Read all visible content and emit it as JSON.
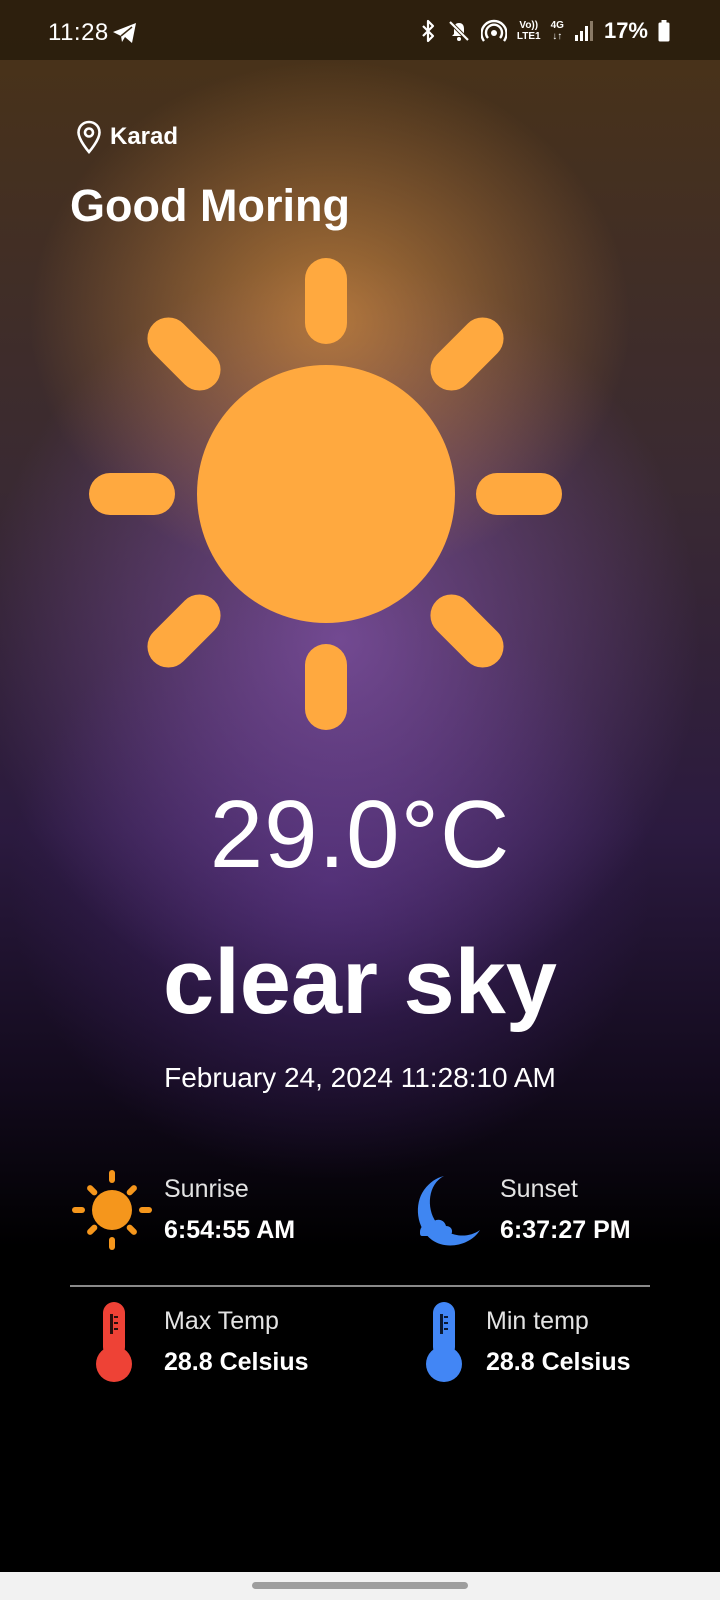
{
  "status_bar": {
    "time": "11:28",
    "battery": "17%",
    "volte_line1": "Vo))",
    "volte_line2": "LTE1",
    "network": "4G",
    "icons": [
      "telegram-icon",
      "bluetooth-icon",
      "mute-icon",
      "hotspot-icon",
      "volte-icon",
      "network-4g-icon",
      "signal-icon",
      "battery-icon"
    ]
  },
  "header": {
    "location": "Karad",
    "greeting": "Good Moring"
  },
  "weather": {
    "icon": "sun-icon",
    "temperature": "29.0°C",
    "condition": "clear sky",
    "datetime": "February 24, 2024 11:28:10 AM"
  },
  "details": {
    "sunrise": {
      "label": "Sunrise",
      "value": "6:54:55 AM",
      "icon": "sunrise-icon"
    },
    "sunset": {
      "label": "Sunset",
      "value": "6:37:27 PM",
      "icon": "moon-cloud-icon"
    },
    "max_temp": {
      "label": "Max Temp",
      "value": "28.8 Celsius",
      "icon": "thermometer-hot-icon"
    },
    "min_temp": {
      "label": "Min temp",
      "value": "28.8 Celsius",
      "icon": "thermometer-cold-icon"
    }
  },
  "colors": {
    "sun": "#FFA93F",
    "sunrise_icon": "#F5961C",
    "moon_icon": "#3F86F2",
    "hot_thermometer": "#EE4236",
    "cold_thermometer": "#4286F5",
    "accent_text": "#FFFFFF"
  }
}
